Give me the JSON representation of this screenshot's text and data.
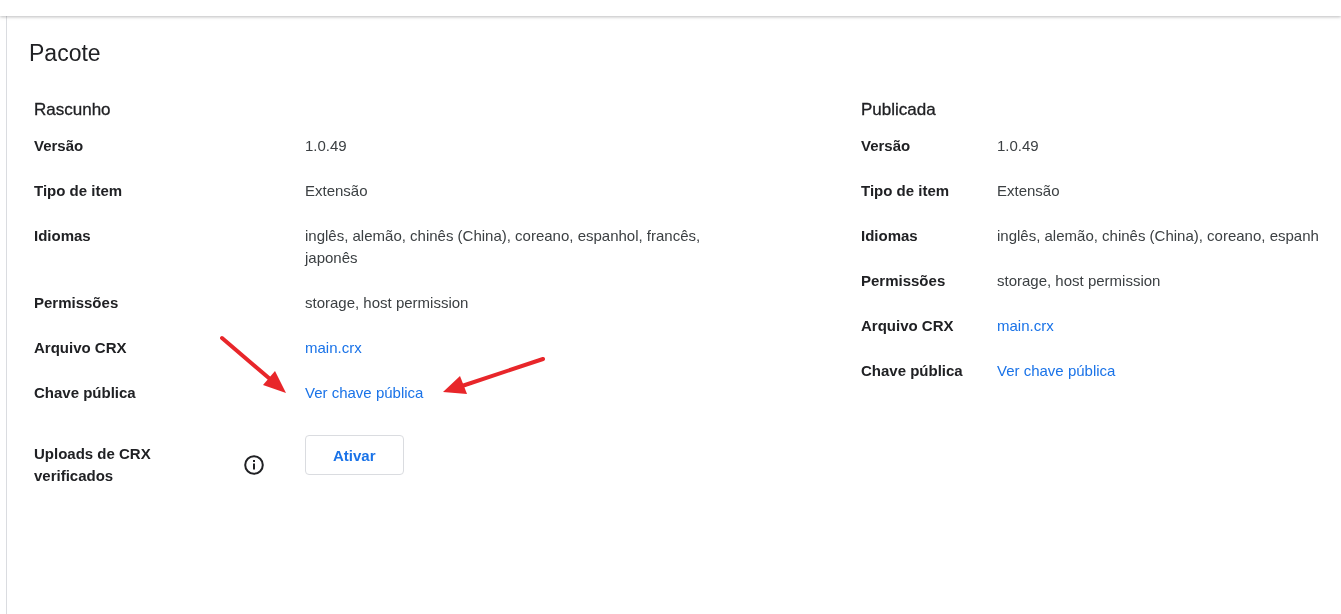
{
  "page": {
    "title": "Pacote"
  },
  "sections": [
    {
      "title": "Rascunho",
      "rows": [
        {
          "kind": "text",
          "label": "Versão",
          "value": "1.0.49"
        },
        {
          "kind": "text",
          "label": "Tipo de item",
          "value": "Extensão"
        },
        {
          "kind": "text",
          "label": "Idiomas",
          "value": "inglês, alemão, chinês (China), coreano, espanhol, francês, japonês"
        },
        {
          "kind": "text",
          "label": "Permissões",
          "value": "storage, host permission"
        },
        {
          "kind": "link",
          "label": "Arquivo CRX",
          "value": "main.crx"
        },
        {
          "kind": "link",
          "label": "Chave pública",
          "value": "Ver chave pública"
        },
        {
          "kind": "button",
          "label": "Uploads de CRX verificados",
          "info_icon": true,
          "value": "Ativar"
        }
      ]
    },
    {
      "title": "Publicada",
      "rows": [
        {
          "kind": "text",
          "label": "Versão",
          "value": "1.0.49"
        },
        {
          "kind": "text",
          "label": "Tipo de item",
          "value": "Extensão"
        },
        {
          "kind": "text",
          "label": "Idiomas",
          "value": "inglês, alemão, chinês (China), coreano, espanh"
        },
        {
          "kind": "text",
          "label": "Permissões",
          "value": "storage, host permission"
        },
        {
          "kind": "link",
          "label": "Arquivo CRX",
          "value": "main.crx"
        },
        {
          "kind": "link",
          "label": "Chave pública",
          "value": "Ver chave pública"
        }
      ]
    }
  ]
}
